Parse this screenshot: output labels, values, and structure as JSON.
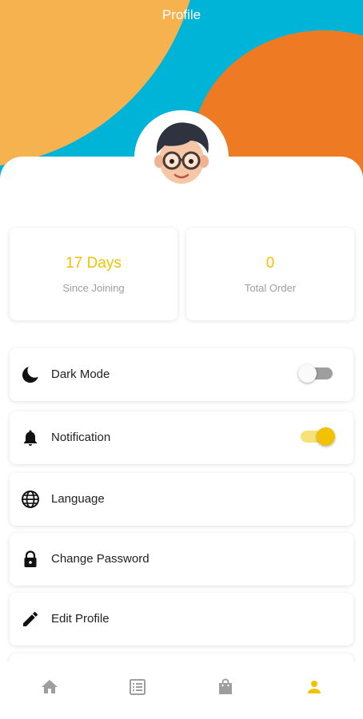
{
  "app": {
    "title": "Profile"
  },
  "stats": [
    {
      "value": "17 Days",
      "label": "Since Joining"
    },
    {
      "value": "0",
      "label": "Total Order"
    }
  ],
  "settings": [
    {
      "label": "Dark Mode",
      "icon": "moon-icon",
      "toggle": false
    },
    {
      "label": "Notification",
      "icon": "bell-icon",
      "toggle": true
    },
    {
      "label": "Language",
      "icon": "globe-icon"
    },
    {
      "label": "Change Password",
      "icon": "lock-icon"
    },
    {
      "label": "Edit Profile",
      "icon": "pencil-icon"
    }
  ],
  "nav": {
    "items": [
      "home-icon",
      "list-icon",
      "shopping-bag-icon",
      "person-icon"
    ],
    "active": "person-icon",
    "active_color": "#f2c200",
    "inactive_color": "#9e9e9e"
  },
  "colors": {
    "accent": "#f2c200",
    "orange": "#ee7b24",
    "light_orange": "#f7b250",
    "cyan": "#00b4d8"
  }
}
